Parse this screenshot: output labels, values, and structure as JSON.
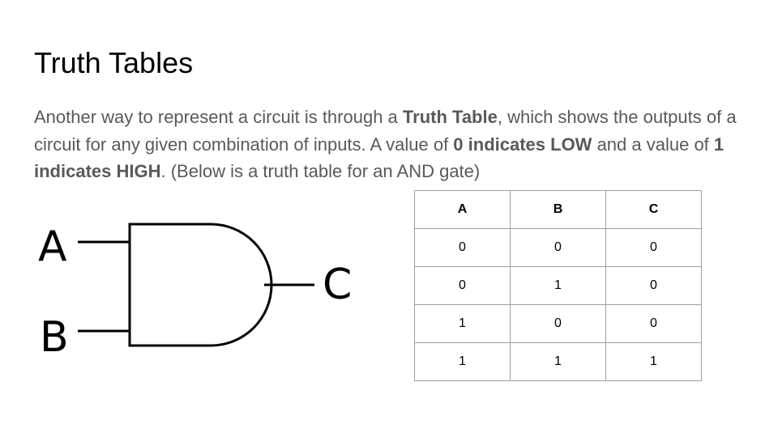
{
  "slide": {
    "title": "Truth Tables",
    "body": {
      "p1": "Another way to represent a circuit is through a ",
      "b1": "Truth Table",
      "p2": ", which shows the outputs of a circuit for any given combination of inputs. A value of ",
      "b2": "0 indicates LOW",
      "p3": " and a value of ",
      "b3": "1 indicates HIGH",
      "p4": ". (Below is a truth table for an AND gate)"
    }
  },
  "gate": {
    "type": "AND",
    "inputs": [
      "A",
      "B"
    ],
    "output": "C"
  },
  "truth_table": {
    "headers": [
      "A",
      "B",
      "C"
    ],
    "rows": [
      [
        "0",
        "0",
        "0"
      ],
      [
        "0",
        "1",
        "0"
      ],
      [
        "1",
        "0",
        "0"
      ],
      [
        "1",
        "1",
        "1"
      ]
    ]
  },
  "colors": {
    "title": "#000000",
    "body_text": "#595959",
    "table_border": "#9e9e9e",
    "gate_stroke": "#000000"
  }
}
